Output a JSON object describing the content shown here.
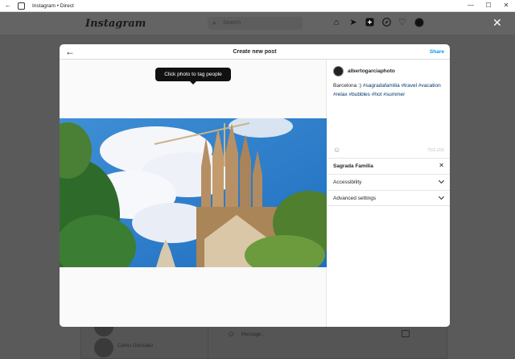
{
  "window": {
    "title": "Instagram • Direct",
    "back_glyph": "←",
    "minimize_glyph": "—",
    "maximize_glyph": "☐",
    "close_glyph": "✕"
  },
  "nav": {
    "logo": "Instagram",
    "search_placeholder": "Search",
    "icons": [
      "home-icon",
      "direct-icon",
      "new-post-icon",
      "explore-icon",
      "activity-icon",
      "profile-avatar"
    ],
    "close_glyph": "✕"
  },
  "background": {
    "contacts": [
      {
        "name": ""
      },
      {
        "name": "Carlos González"
      }
    ],
    "message_placeholder": "Message..."
  },
  "modal": {
    "back_glyph": "←",
    "title": "Create new post",
    "share_label": "Share",
    "tooltip": "Click photo to tag people",
    "username": "albertogarciaphoto",
    "caption_text": "Barcelona :) ",
    "hashtags": [
      "#sagradafamilia",
      "#travel",
      "#vacation",
      "#relax",
      "#bubbles",
      "#hot",
      "#summer"
    ],
    "char_count": "79/2,200",
    "location": "Sagrada Familia",
    "location_clear_glyph": "✕",
    "sections": [
      "Accessibility",
      "Advanced settings"
    ],
    "colors": {
      "accent": "#0095f6",
      "hashtag": "#00376b",
      "overlay": "#5a5a5a"
    }
  }
}
